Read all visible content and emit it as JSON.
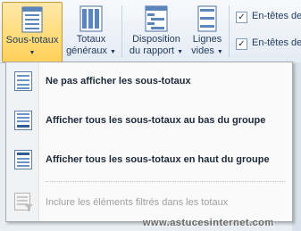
{
  "ribbon": {
    "buttons": [
      {
        "label": "Sous-totaux",
        "icon": "subtotals-icon",
        "dropdown": true
      },
      {
        "label1": "Totaux",
        "label2": "généraux",
        "icon": "grand-totals-icon"
      },
      {
        "label1": "Disposition",
        "label2": "du rapport",
        "icon": "report-layout-icon"
      },
      {
        "label1": "Lignes",
        "label2": "vides",
        "icon": "blank-rows-icon"
      }
    ],
    "checkboxes": [
      {
        "label": "En-têtes de",
        "checked": true
      },
      {
        "label": "En-têtes de",
        "checked": true
      }
    ]
  },
  "menu": {
    "items": [
      {
        "label": "Ne pas afficher les sous-totaux",
        "icon": "no-subtotals-icon",
        "enabled": true
      },
      {
        "label": "Afficher tous les sous-totaux au bas du groupe",
        "icon": "subtotals-bottom-icon",
        "enabled": true
      },
      {
        "label": "Afficher tous les sous-totaux en haut du groupe",
        "icon": "subtotals-top-icon",
        "enabled": true
      },
      {
        "label": "Inclure les éléments filtrés dans les totaux",
        "icon": "filtered-totals-icon",
        "enabled": false
      }
    ]
  },
  "watermark": "www.astucesinternet.com",
  "colors": {
    "active_button": "#ffd15a",
    "accent_blue": "#1e395b"
  }
}
